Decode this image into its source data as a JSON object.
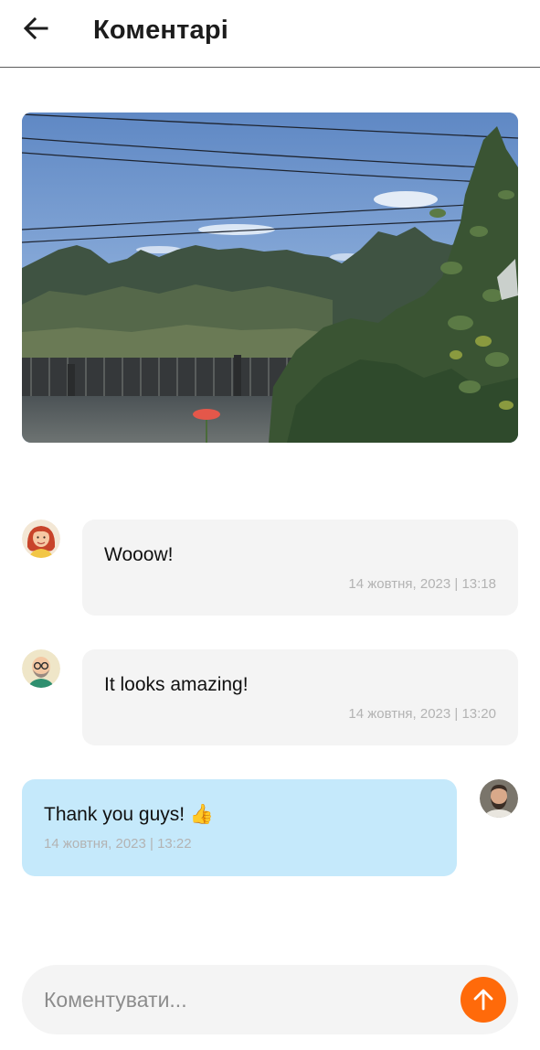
{
  "header": {
    "title": "Коментарі",
    "back_icon": "arrow-left-icon"
  },
  "post": {
    "photo": "garden-photo"
  },
  "comments": [
    {
      "author_avatar": "red-haired-woman-avatar",
      "text": "Wooow!",
      "time": "14 жовтня, 2023 | 13:18",
      "own": false
    },
    {
      "author_avatar": "bald-man-glasses-avatar",
      "text": "It looks amazing!",
      "time": "14 жовтня, 2023 | 13:20",
      "own": false
    },
    {
      "author_avatar": "bearded-man-photo-avatar",
      "text": "Thank you guys! 👍",
      "time": "14 жовтня, 2023 | 13:22",
      "own": true
    }
  ],
  "composer": {
    "placeholder": "Коментувати...",
    "value": "",
    "send_icon": "arrow-up-icon"
  },
  "colors": {
    "accent": "#ff6a0a",
    "own_bubble": "#c5e9fb",
    "other_bubble": "#f4f4f4",
    "timestamp": "#b3b3b3"
  }
}
